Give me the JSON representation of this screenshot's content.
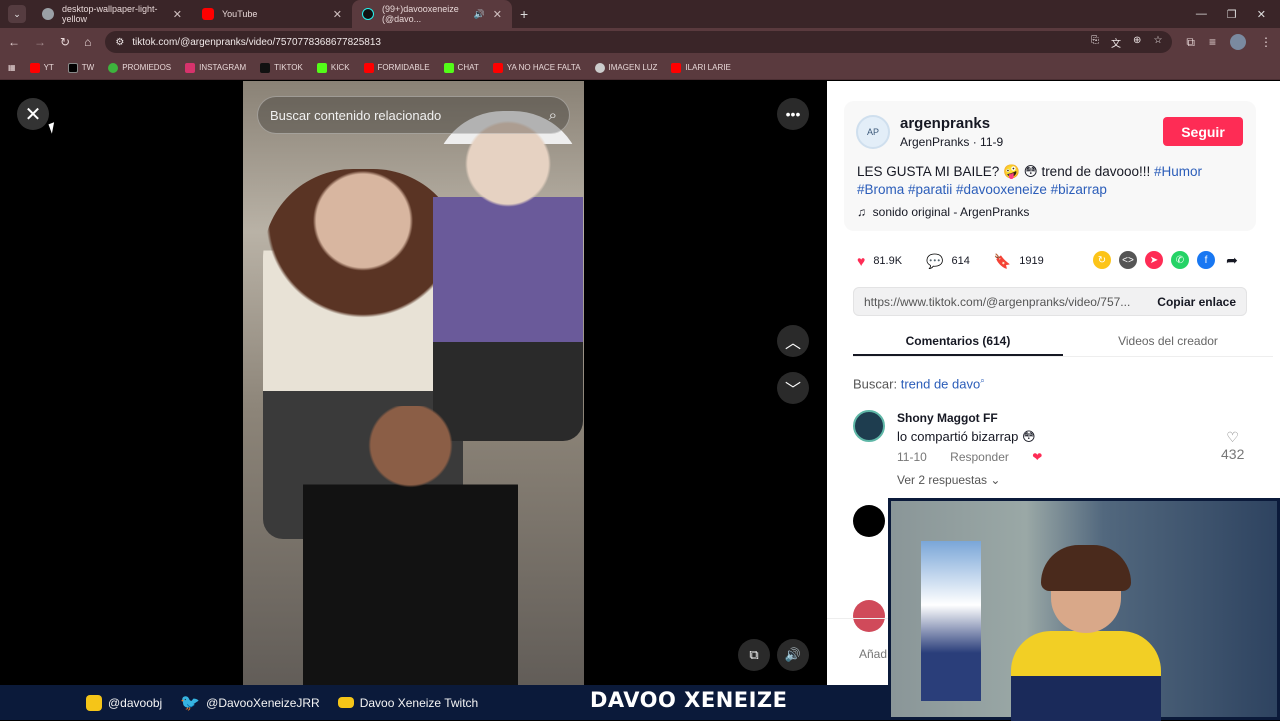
{
  "browser": {
    "tabs": [
      {
        "label": "desktop-wallpaper-light-yellow"
      },
      {
        "label": "YouTube"
      },
      {
        "label": "(99+)davooxeneize (@davo..."
      }
    ],
    "url": "tiktok.com/@argenpranks/video/7570778368677825813",
    "bookmarks": [
      "YT",
      "TW",
      "PROMIEDOS",
      "INSTAGRAM",
      "TIKTOK",
      "KICK",
      "FORMIDABLE",
      "CHAT",
      "YA NO HACE FALTA",
      "IMAGEN LUZ",
      "ILARI LARIE"
    ]
  },
  "viewer": {
    "search_placeholder": "Buscar contenido relacionado"
  },
  "panel": {
    "username": "argenpranks",
    "display_name": "ArgenPranks · 11-9",
    "follow_label": "Seguir",
    "desc_text": "LES GUSTA MI BAILE? 🤪 😳 trend de davooo!!! ",
    "hashtags_line1": "#Humor",
    "hashtags_line2": "#Broma #paratii #davooxeneize #bizarrap",
    "sound": "sonido original - ArgenPranks",
    "likes": "81.9K",
    "comments": "614",
    "saves": "1919",
    "link": "https://www.tiktok.com/@argenpranks/video/757...",
    "copy_label": "Copiar enlace",
    "tab_comments": "Comentarios (614)",
    "tab_videos": "Videos del creador",
    "buscar_label": "Buscar:",
    "buscar_term": "trend de davo",
    "comment": {
      "author": "Shony Maggot FF",
      "text": "lo compartió bizarrap 😳",
      "date": "11-10",
      "reply": "Responder",
      "likes": "432",
      "more": "Ver 2 respuestas ⌄"
    },
    "add_comment": "Añad"
  },
  "footer": {
    "instagram": "@davoobj",
    "twitter": "@DavooXeneizeJRR",
    "youtube": "Davoo Xeneize Twitch",
    "brand": "DAVOO XENEIZE"
  }
}
